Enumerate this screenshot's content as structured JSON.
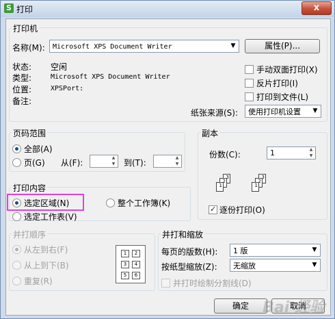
{
  "window": {
    "title": "打印",
    "app_icon": "S",
    "close_glyph": "x"
  },
  "printer": {
    "group_title": "打印机",
    "name_label": "名称(M):",
    "name_value": "Microsoft XPS Document Writer",
    "properties_button": "属性(P)...",
    "status_label": "状态:",
    "status_value": "空闲",
    "type_label": "类型:",
    "type_value": "Microsoft XPS Document Writer",
    "location_label": "位置:",
    "location_value": "XPSPort:",
    "comment_label": "备注:",
    "manual_duplex_label": "手动双面打印(X)",
    "manual_duplex_checked": false,
    "reverse_label": "反片打印(I)",
    "reverse_checked": false,
    "print_to_file_label": "打印到文件(L)",
    "print_to_file_checked": false,
    "paper_source_label": "纸张来源(S):",
    "paper_source_value": "使用打印机设置"
  },
  "page_range": {
    "group_title": "页码范围",
    "all_label": "全部(A)",
    "all_checked": true,
    "pages_label": "页(G)",
    "from_label": "从(F):",
    "from_value": "",
    "to_label": "到(T):",
    "to_value": ""
  },
  "copies": {
    "group_title": "副本",
    "count_label": "份数(C):",
    "count_value": "1",
    "collate_label": "逐份打印(O)",
    "collate_checked": true,
    "stack1_pages": [
      "1",
      "2",
      "3"
    ],
    "stack2_pages": [
      "1",
      "2",
      "3"
    ]
  },
  "print_content": {
    "group_title": "打印内容",
    "selection_label": "选定区域(N)",
    "selection_checked": true,
    "workbook_label": "整个工作簿(K)",
    "worksheet_label": "选定工作表(V)"
  },
  "collate_order": {
    "group_title": "并打顺序",
    "left_to_right_label": "从左到右(F)",
    "top_to_bottom_label": "从上到下(B)",
    "repeat_label": "重复(R)",
    "preview_cells": [
      "1",
      "2",
      "3",
      "4",
      "5",
      "6"
    ]
  },
  "scaling": {
    "group_title": "并打和缩放",
    "pages_per_sheet_label": "每页的版数(H):",
    "pages_per_sheet_value": "1 版",
    "scale_label": "按纸型缩放(Z):",
    "scale_value": "无缩放",
    "draw_borders_label": "并打时绘制分割线(D)"
  },
  "buttons": {
    "ok": "确定",
    "cancel": "取消"
  },
  "watermark": "Bai 经验"
}
